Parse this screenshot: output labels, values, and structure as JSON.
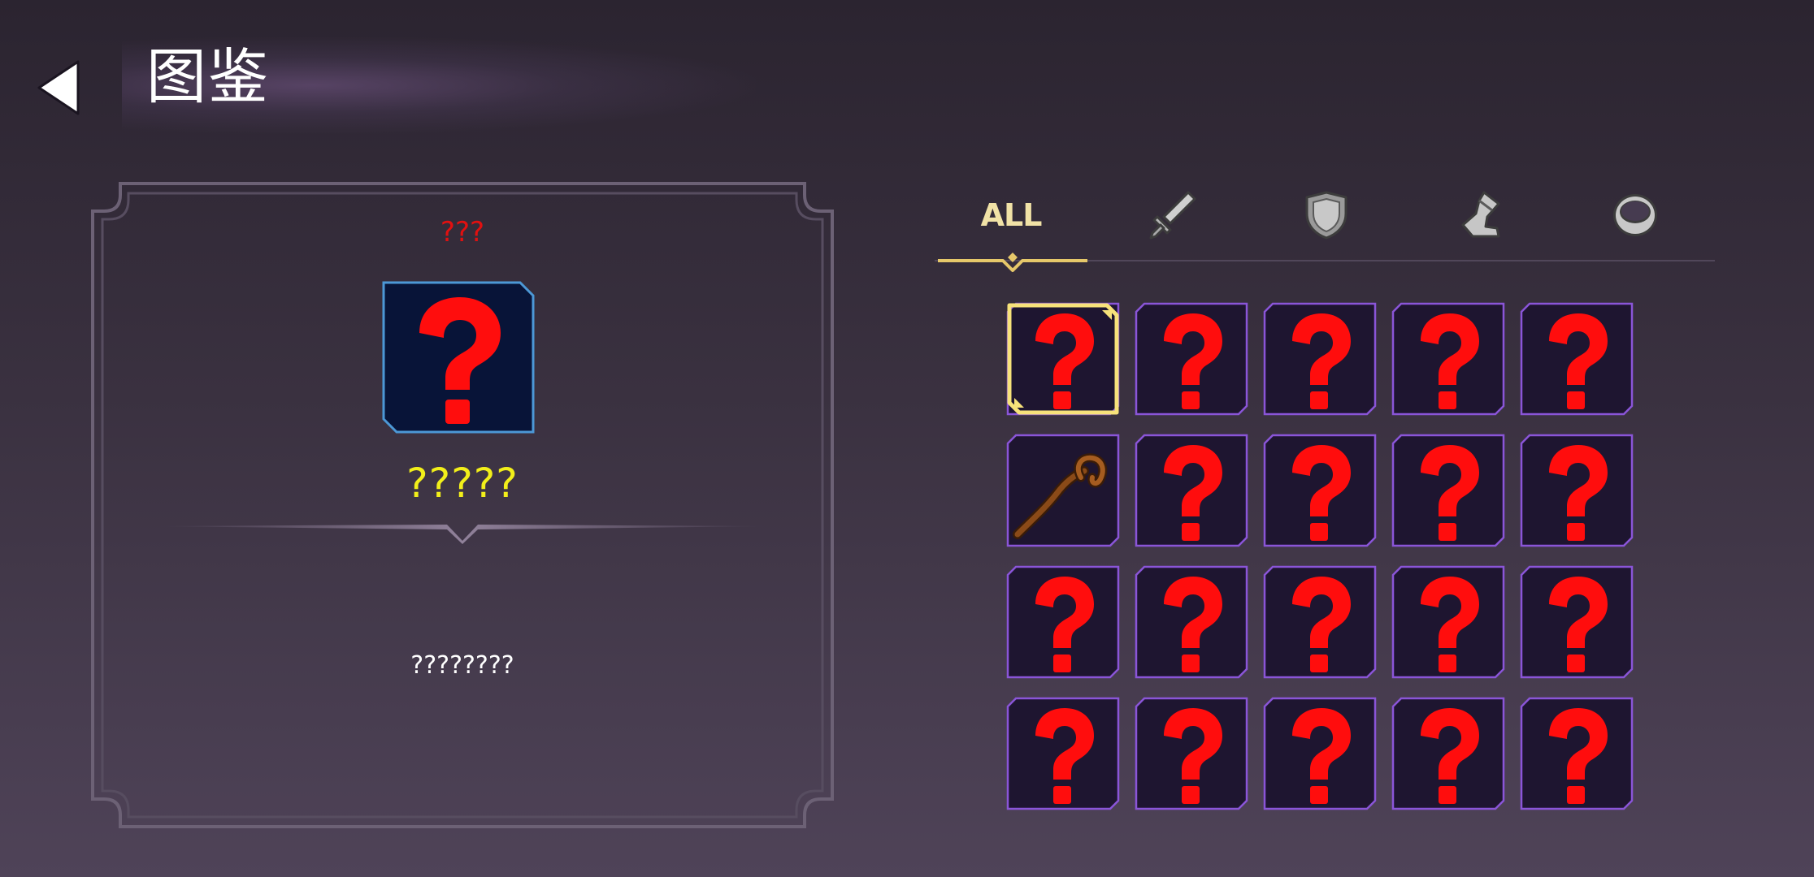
{
  "header": {
    "title": "图鉴"
  },
  "detail": {
    "rarity": "???",
    "name": "?????",
    "description": "????????"
  },
  "tabs": [
    {
      "id": "all",
      "label": "ALL",
      "selected": true
    },
    {
      "id": "weapon",
      "icon": "sword-icon",
      "selected": false
    },
    {
      "id": "armor",
      "icon": "shield-icon",
      "selected": false
    },
    {
      "id": "boots",
      "icon": "boot-icon",
      "selected": false
    },
    {
      "id": "ring",
      "icon": "ring-icon",
      "selected": false
    }
  ],
  "grid": {
    "items": [
      {
        "icon": "question-mark-icon",
        "selected": true
      },
      {
        "icon": "question-mark-icon"
      },
      {
        "icon": "question-mark-icon"
      },
      {
        "icon": "question-mark-icon"
      },
      {
        "icon": "question-mark-icon"
      },
      {
        "icon": "staff-icon"
      },
      {
        "icon": "question-mark-icon"
      },
      {
        "icon": "question-mark-icon"
      },
      {
        "icon": "question-mark-icon"
      },
      {
        "icon": "question-mark-icon"
      },
      {
        "icon": "question-mark-icon"
      },
      {
        "icon": "question-mark-icon"
      },
      {
        "icon": "question-mark-icon"
      },
      {
        "icon": "question-mark-icon"
      },
      {
        "icon": "question-mark-icon"
      },
      {
        "icon": "question-mark-icon"
      },
      {
        "icon": "question-mark-icon"
      },
      {
        "icon": "question-mark-icon"
      },
      {
        "icon": "question-mark-icon"
      },
      {
        "icon": "question-mark-icon"
      }
    ]
  },
  "colors": {
    "rarity": "#e11010",
    "name": "#f2ef1a",
    "question": "#ff0d0d",
    "cell_bg": "#1e1530",
    "cell_border": "#8a55d8",
    "selected_border": "#f7e27a",
    "big_icon_bg": "#081438",
    "big_icon_border": "#4c98d6",
    "tab_accent": "#e6c86a"
  }
}
